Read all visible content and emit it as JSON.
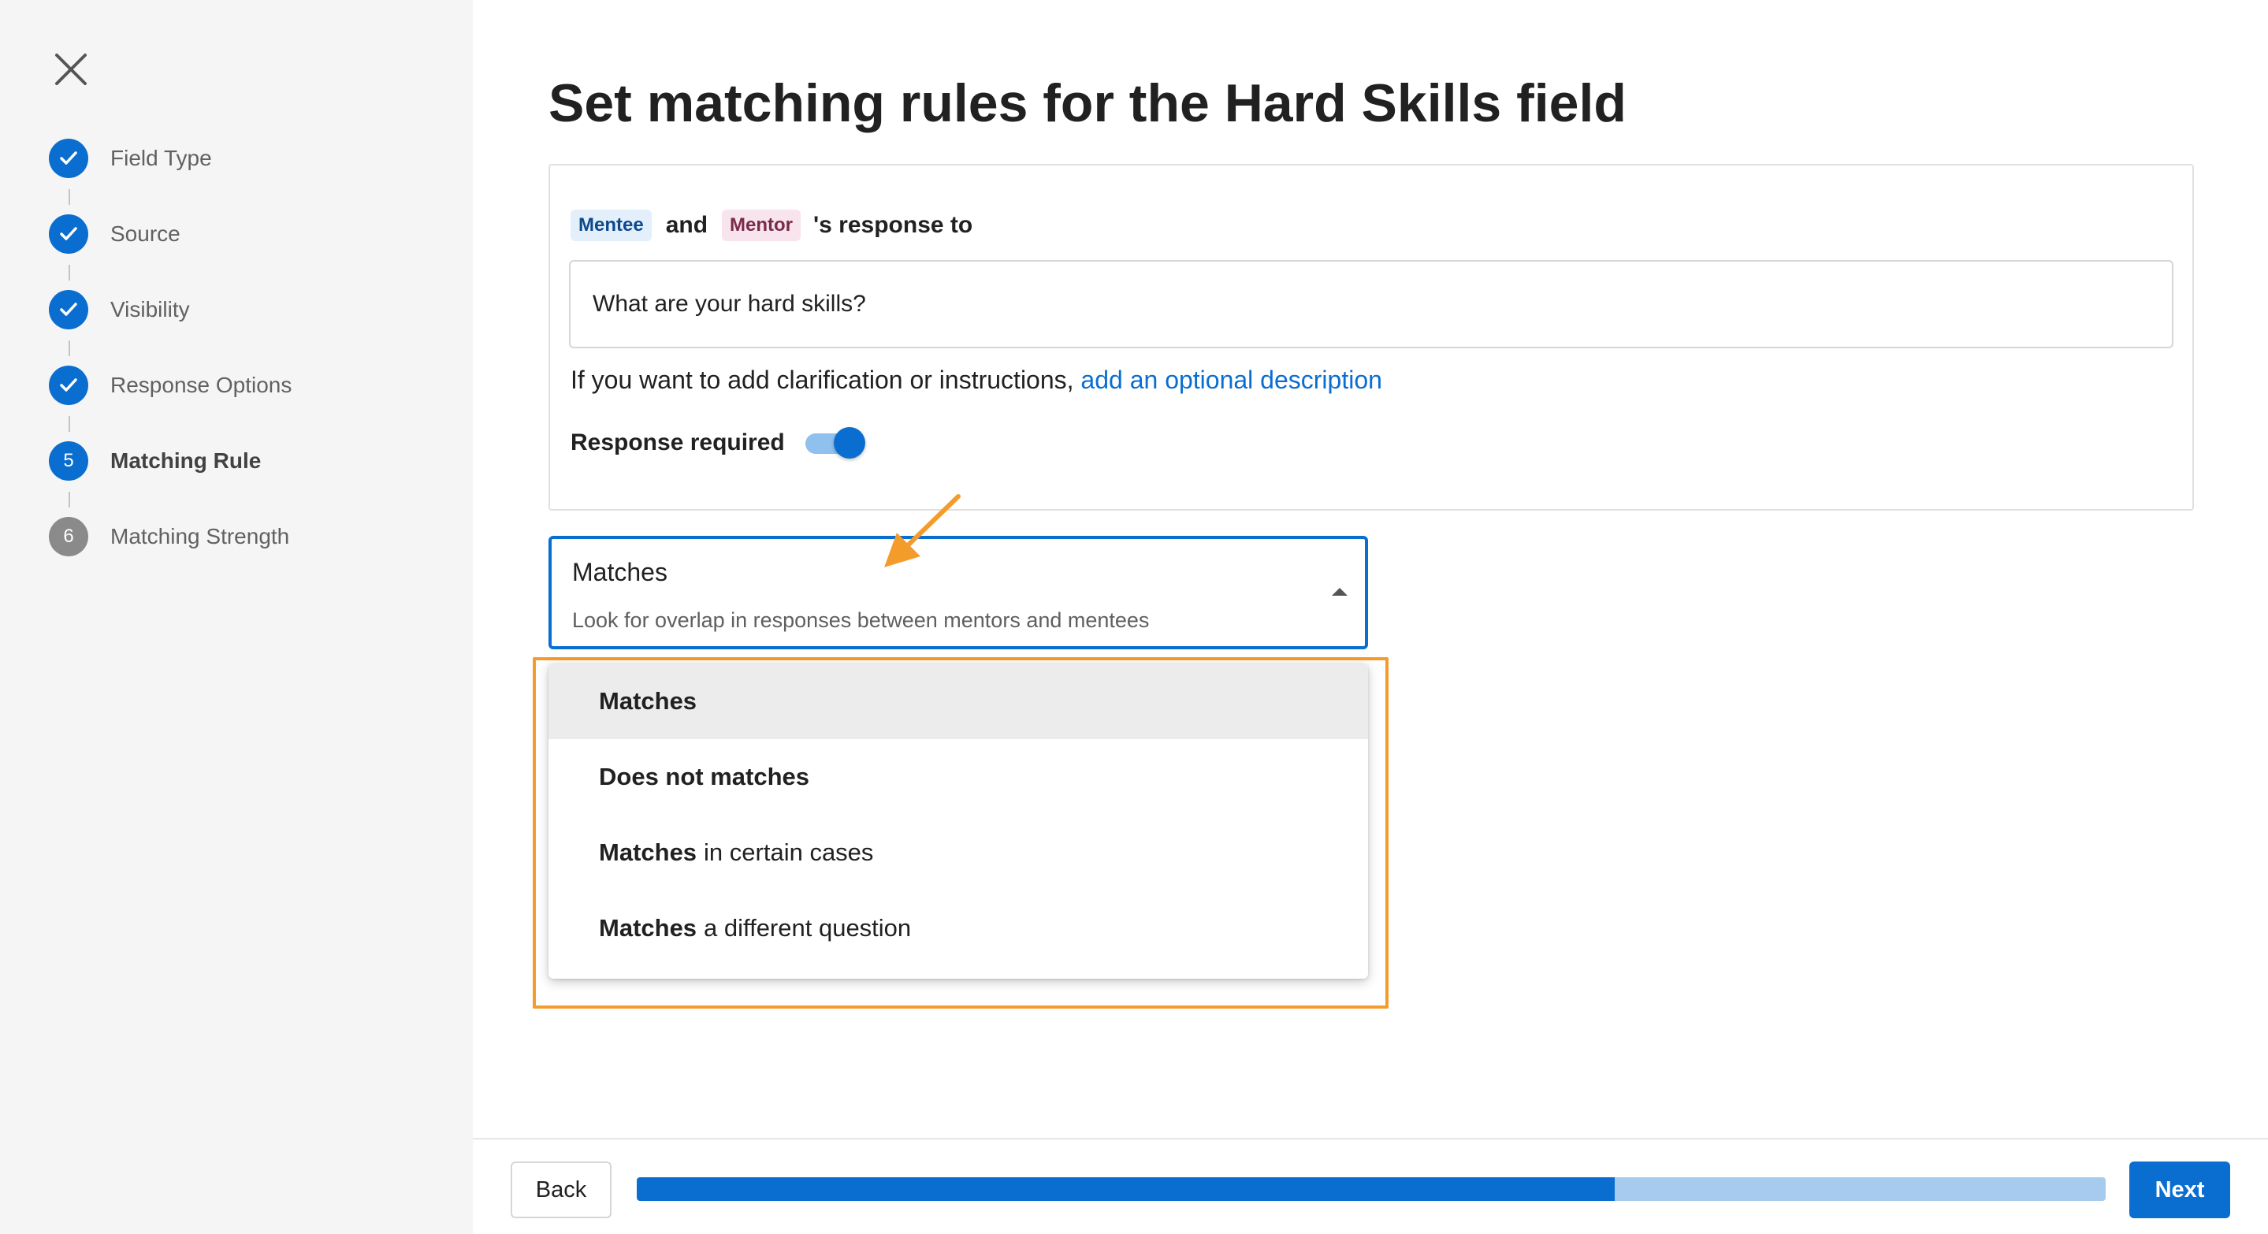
{
  "sidebar": {
    "steps": [
      {
        "label": "Field Type",
        "state": "done"
      },
      {
        "label": "Source",
        "state": "done"
      },
      {
        "label": "Visibility",
        "state": "done"
      },
      {
        "label": "Response Options",
        "state": "done"
      },
      {
        "label": "Matching Rule",
        "state": "current",
        "number": "5"
      },
      {
        "label": "Matching Strength",
        "state": "pending",
        "number": "6"
      }
    ]
  },
  "main": {
    "title": "Set matching rules for the Hard Skills field",
    "response": {
      "mentee_tag": "Mentee",
      "and": "and",
      "mentor_tag": "Mentor",
      "suffix": "'s response to",
      "question_value": "What are your hard skills?",
      "help_prefix": "If you want to add clarification or instructions,",
      "help_link": "add an optional description",
      "required_label": "Response required",
      "required_on": true
    },
    "select": {
      "value": "Matches",
      "description": "Look for overlap in responses between mentors and mentees"
    },
    "dropdown": {
      "options": [
        {
          "strong": "Matches",
          "rest": ""
        },
        {
          "strong": "Does not matches",
          "rest": ""
        },
        {
          "strong": "Matches",
          "rest": "in certain cases"
        },
        {
          "strong": "Matches",
          "rest": "a different question"
        }
      ]
    }
  },
  "footer": {
    "back_label": "Back",
    "next_label": "Next",
    "progress": 0.666
  },
  "colors": {
    "accent": "#0a6ed1",
    "highlight": "#f39c2c",
    "progress_track": "#a7cbef"
  }
}
